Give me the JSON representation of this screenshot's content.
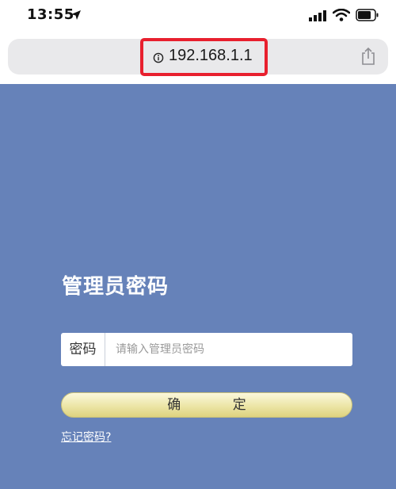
{
  "status_bar": {
    "time": "13:55",
    "icons": [
      "location-arrow-icon",
      "signal-icon",
      "wifi-icon",
      "battery-icon"
    ]
  },
  "browser": {
    "url": "192.168.1.1",
    "highlight_color": "#e8202e",
    "icons": [
      "info-icon",
      "share-icon"
    ]
  },
  "login": {
    "title": "管理员密码",
    "password_label": "密码",
    "password_placeholder": "请输入管理员密码",
    "password_value": "",
    "confirm_label": "确 定",
    "forgot_link": "忘记密码?"
  },
  "colors": {
    "panel_background": "#6682b9",
    "button_gold": "#ece5a6",
    "url_bar": "#e9e9eb"
  }
}
